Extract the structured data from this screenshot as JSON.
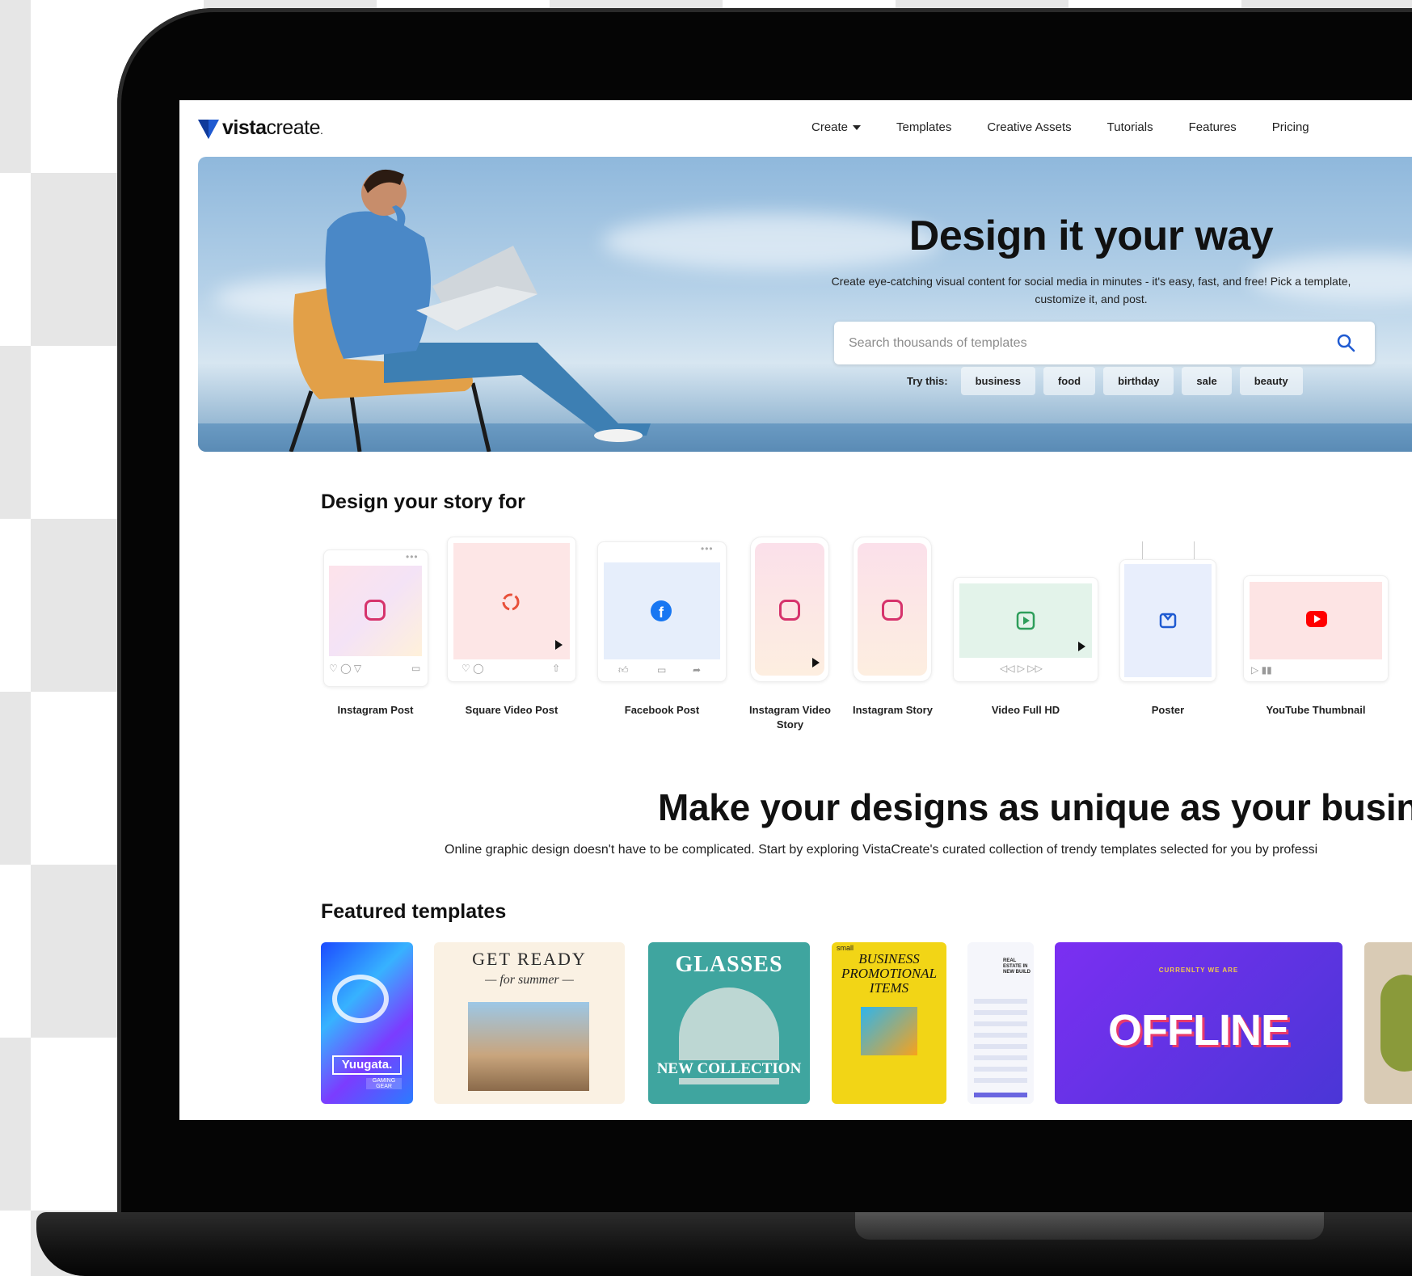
{
  "logo": {
    "text_bold": "vista",
    "text_regular": "create",
    "suffix": "."
  },
  "nav": {
    "create": "Create",
    "templates": "Templates",
    "creative_assets": "Creative Assets",
    "tutorials": "Tutorials",
    "features": "Features",
    "pricing": "Pricing"
  },
  "hero": {
    "title": "Design it your way",
    "subtitle": "Create eye-catching visual content for social media in minutes - it's easy, fast, and free! Pick a template, customize it, and post.",
    "search_placeholder": "Search thousands of templates",
    "try_label": "Try this:",
    "chips": [
      "business",
      "food",
      "birthday",
      "sale",
      "beauty"
    ]
  },
  "story": {
    "title": "Design your story for",
    "formats": [
      {
        "label": "Instagram Post",
        "icon": "instagram-icon"
      },
      {
        "label": "Square Video Post",
        "icon": "refresh-icon"
      },
      {
        "label": "Facebook Post",
        "icon": "facebook-icon"
      },
      {
        "label": "Instagram Video Story",
        "icon": "instagram-icon"
      },
      {
        "label": "Instagram Story",
        "icon": "instagram-icon"
      },
      {
        "label": "Video Full HD",
        "icon": "video-play-icon"
      },
      {
        "label": "Poster",
        "icon": "poster-icon"
      },
      {
        "label": "YouTube Thumbnail",
        "icon": "youtube-icon"
      }
    ]
  },
  "unique": {
    "title": "Make your designs as unique as your busines",
    "subtitle": "Online graphic design doesn't have to be complicated. Start by exploring VistaCreate's curated collection of trendy templates selected for you by professi"
  },
  "featured": {
    "title": "Featured templates",
    "templates": [
      {
        "brand": "Yuugata.",
        "tag": "GAMING GEAR"
      },
      {
        "heading": "GET READY",
        "sub": "— for summer —"
      },
      {
        "heading": "GLASSES",
        "sub": "NEW COLLECTION"
      },
      {
        "small": "small",
        "heading": "BUSINESS PROMOTIONAL ITEMS"
      },
      {
        "heading": "REAL ESTATE IN NEW BUILD"
      },
      {
        "kicker": "CURRENLTY WE ARE",
        "heading": "OFFLINE"
      }
    ]
  },
  "colors": {
    "brand_blue": "#1f5ad1",
    "instagram": "#d6336c",
    "facebook": "#1877f2",
    "youtube": "#ff0000",
    "video_green": "#2e9e5b"
  }
}
